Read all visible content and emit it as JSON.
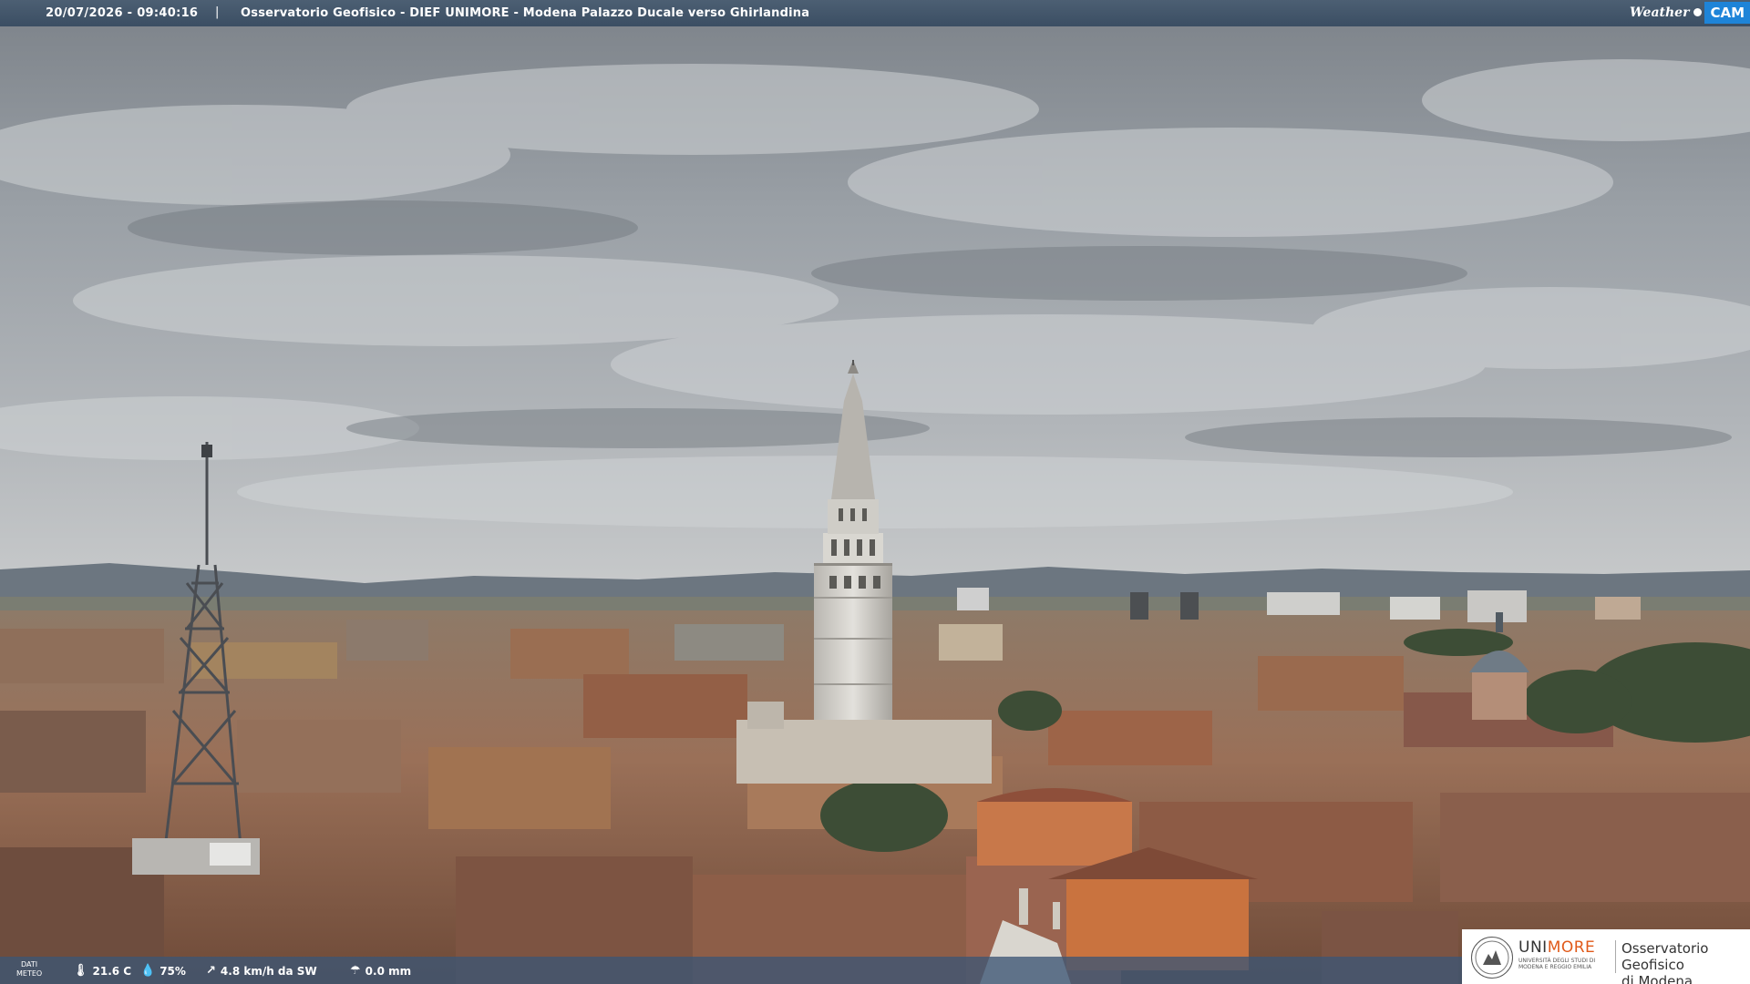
{
  "header": {
    "timestamp": "20/07/2026 - 09:40:16",
    "separator": "|",
    "caption": "Osservatorio Geofisico - DIEF UNIMORE - Modena Palazzo Ducale verso Ghirlandina"
  },
  "brand": {
    "weather": "Weather",
    "cam": "CAM",
    "cam_color": "#1e84d8"
  },
  "weather": {
    "dati_label_line1": "DATI",
    "dati_label_line2": "METEO",
    "temperature": "21.6 C",
    "humidity": "75%",
    "wind": "4.8 km/h da SW",
    "rain": "0.0 mm"
  },
  "badge": {
    "uni_prefix": "UNI",
    "uni_suffix": "MORE",
    "uni_sub": "UNIVERSITÀ DEGLI STUDI DI MODENA E REGGIO EMILIA",
    "obs_line1": "Osservatorio Geofisico",
    "obs_line2": "di Modena"
  }
}
